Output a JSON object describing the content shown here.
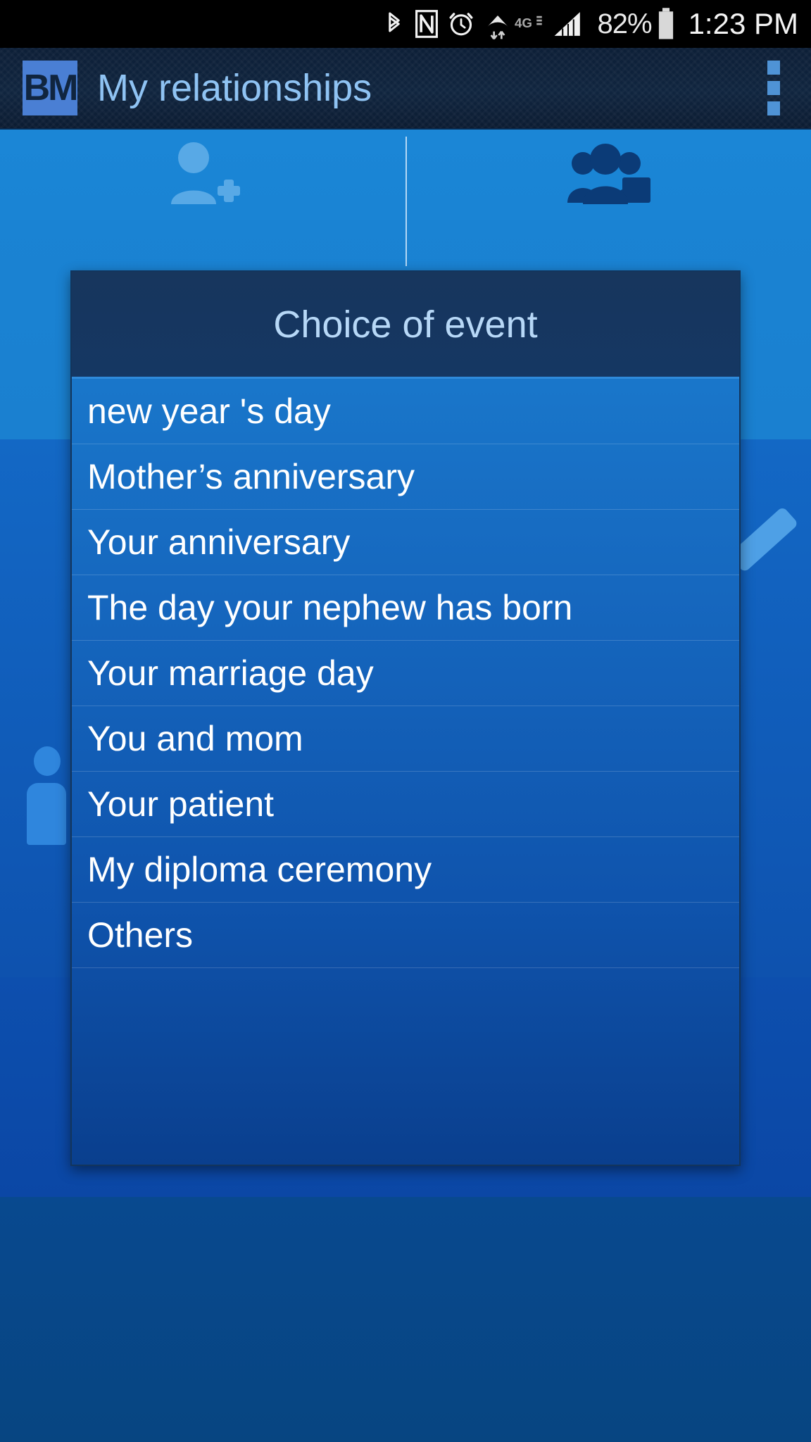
{
  "status_bar": {
    "icons": [
      "bluetooth-icon",
      "nfc-icon",
      "alarm-icon",
      "wifi-icon",
      "4g-icon",
      "cellular-signal-icon"
    ],
    "network_label": "4G",
    "battery_percent": "82%",
    "clock": "1:23 PM"
  },
  "app_bar": {
    "logo_text": "BM",
    "title": "My relationships",
    "overflow_icon": "more-vertical-icon"
  },
  "tabs": [
    {
      "id": "add-person",
      "icon": "person-add-icon",
      "selected": false
    },
    {
      "id": "relationships",
      "icon": "people-group-icon",
      "selected": true
    }
  ],
  "background": {
    "avatar_icon": "person-icon",
    "edit_icon": "pencil-edit-icon"
  },
  "dialog": {
    "title": "Choice of event",
    "items": [
      "new year 's day",
      "Mother’s anniversary",
      "Your anniversary",
      "The day your nephew has born",
      "Your marriage day",
      "You and mom",
      "Your patient",
      "My diploma ceremony",
      "Others"
    ]
  },
  "colors": {
    "status_bar_bg": "#000000",
    "app_bar_bg": "#10253f",
    "app_title": "#8fc3f3",
    "tab_bar_bg": "#1a84d4",
    "dialog_header_bg": "#17365d",
    "dialog_title": "#b7d8f7",
    "accent_blue": "#1b7ed0",
    "logo_bg": "#4a7fd4"
  }
}
